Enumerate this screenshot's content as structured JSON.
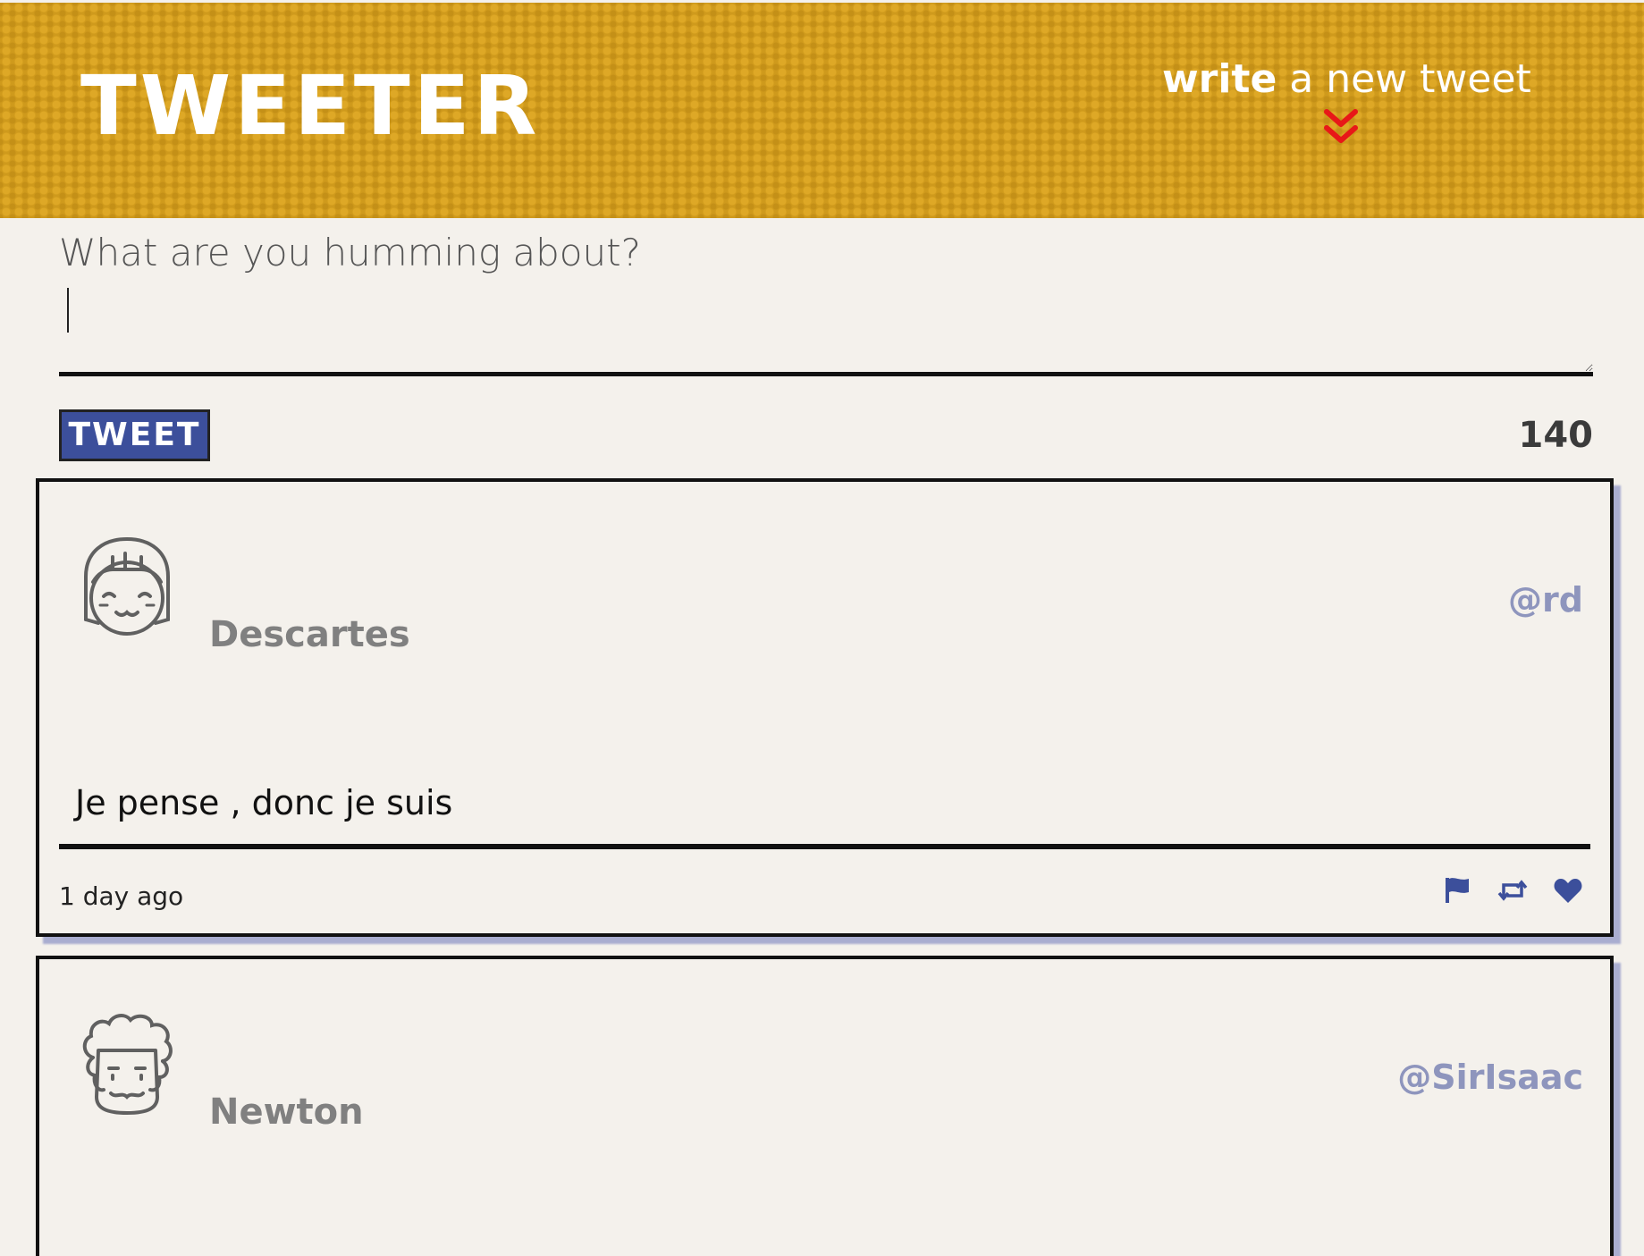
{
  "header": {
    "brand": "TWEETER",
    "compose_strong": "write",
    "compose_light": " a new tweet",
    "chevron_icon": "double-chevron-down-icon"
  },
  "compose": {
    "placeholder": "What are you humming about?",
    "button_label": "TWEET",
    "counter": "140"
  },
  "tweets": [
    {
      "name": "Descartes",
      "handle": "@rd",
      "avatar_icon": "girl-avatar-icon",
      "content": "Je pense , donc je suis",
      "time": "1 day ago",
      "actions": [
        "flag-icon",
        "retweet-icon",
        "heart-icon"
      ]
    },
    {
      "name": "Newton",
      "handle": "@SirIsaac",
      "avatar_icon": "curly-hair-avatar-icon"
    }
  ],
  "colors": {
    "header_bg": "#cf9a1c",
    "page_bg": "#f4f1ec",
    "accent": "#3c4f9b",
    "chevron": "#e81818",
    "handle": "#8e95bd"
  }
}
